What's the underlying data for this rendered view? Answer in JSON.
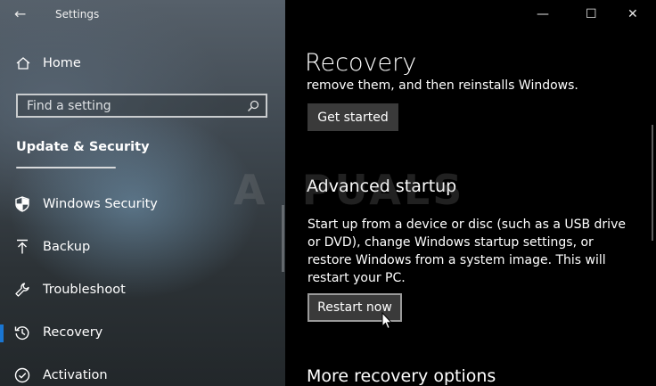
{
  "window": {
    "title": "Settings",
    "controls": {
      "minimize": "—",
      "maximize": "☐",
      "close": "✕"
    }
  },
  "sidebar": {
    "home_label": "Home",
    "search_placeholder": "Find a setting",
    "section_title": "Update & Security",
    "items": [
      {
        "label": "Windows Security",
        "icon": "shield-icon"
      },
      {
        "label": "Backup",
        "icon": "backup-arrow-icon"
      },
      {
        "label": "Troubleshoot",
        "icon": "wrench-icon"
      },
      {
        "label": "Recovery",
        "icon": "history-icon",
        "selected": true
      },
      {
        "label": "Activation",
        "icon": "check-circle-icon"
      }
    ],
    "accent_color": "#1a76d2"
  },
  "main": {
    "page_title": "Recovery",
    "partial_text": "remove them, and then reinstalls Windows.",
    "get_started_label": "Get started",
    "advanced_startup": {
      "heading": "Advanced startup",
      "description": "Start up from a device or disc (such as a USB drive or DVD), change Windows startup settings, or restore Windows from a system image. This will restart your PC.",
      "button_label": "Restart now"
    },
    "more_options_heading": "More recovery options"
  },
  "watermark_text": "A PUALS"
}
